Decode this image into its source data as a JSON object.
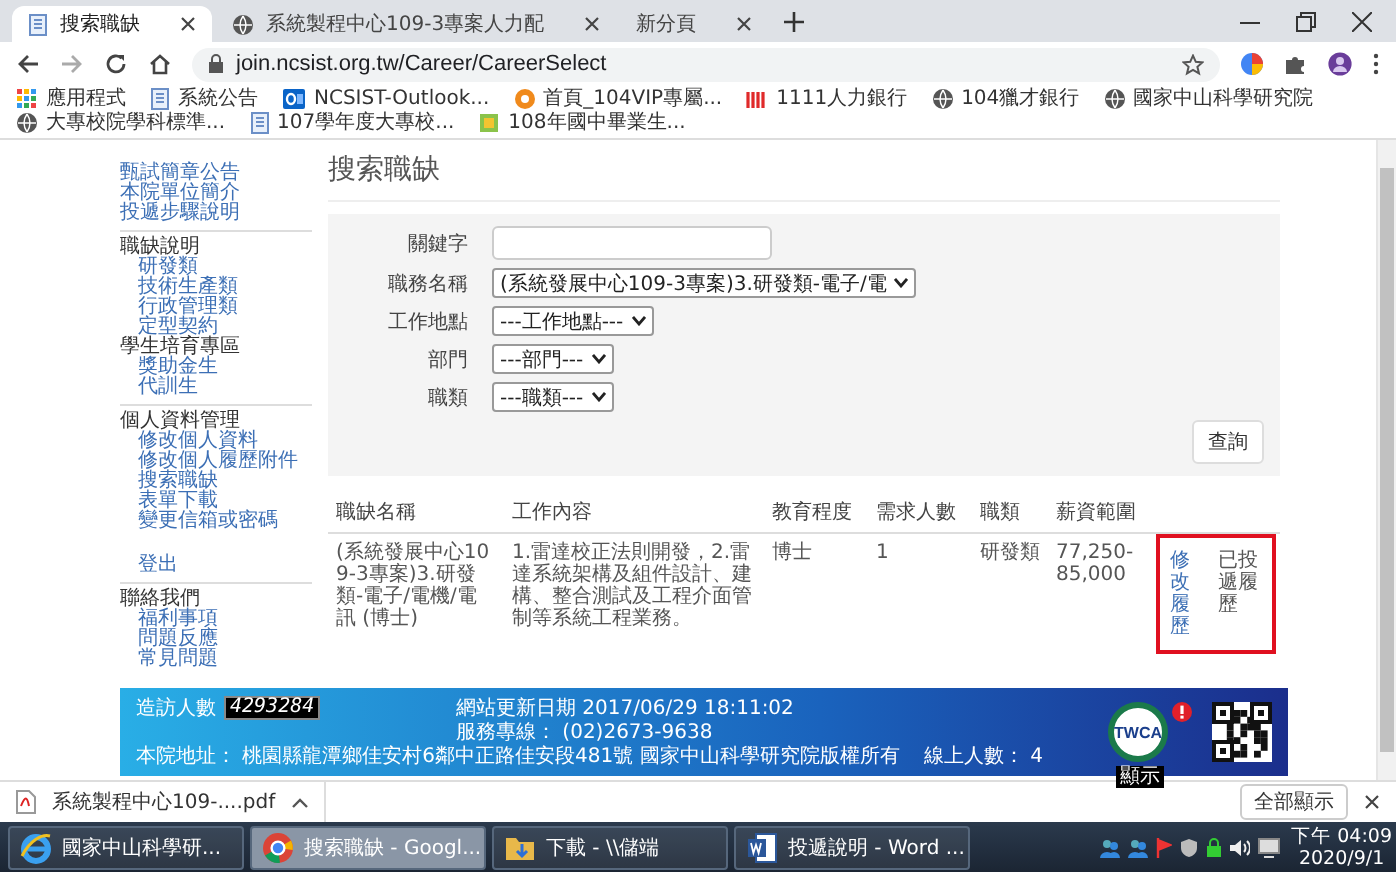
{
  "browser": {
    "tabs": [
      {
        "title": "搜索職缺",
        "kind": "page",
        "selected": true
      },
      {
        "title": "系統製程中心109-3專案人力配",
        "kind": "globe",
        "selected": false
      },
      {
        "title": "新分頁",
        "kind": "blank",
        "selected": false
      }
    ],
    "url": "join.ncsist.org.tw/Career/CareerSelect",
    "bookmarks": [
      {
        "label": "應用程式",
        "kind": "apps"
      },
      {
        "label": "系統公告",
        "kind": "page"
      },
      {
        "label": "NCSIST-Outlook...",
        "kind": "mail"
      },
      {
        "label": "首頁_104VIP專屬...",
        "kind": "badge"
      },
      {
        "label": "1111人力銀行",
        "kind": "bars"
      },
      {
        "label": "104獵才銀行",
        "kind": "globe"
      },
      {
        "label": "國家中山科學研究院",
        "kind": "globe"
      },
      {
        "label": "大專校院學科標準...",
        "kind": "globe"
      },
      {
        "label": "107學年度大專校...",
        "kind": "page"
      },
      {
        "label": "108年國中畢業生...",
        "kind": "book"
      }
    ]
  },
  "sidebar": {
    "groups": [
      {
        "divider": false,
        "items": [
          {
            "kind": "link",
            "label": "甄試簡章公告"
          },
          {
            "kind": "link",
            "label": "本院單位簡介"
          },
          {
            "kind": "link",
            "label": "投遞步驟說明"
          }
        ]
      },
      {
        "divider": true,
        "items": [
          {
            "kind": "header",
            "label": "職缺說明"
          },
          {
            "kind": "sublink",
            "label": "研發類"
          },
          {
            "kind": "sublink",
            "label": "技術生產類"
          },
          {
            "kind": "sublink",
            "label": "行政管理類"
          },
          {
            "kind": "sublink",
            "label": "定型契約"
          },
          {
            "kind": "header",
            "label": "學生培育專區"
          },
          {
            "kind": "sublink",
            "label": "獎助金生"
          },
          {
            "kind": "sublink",
            "label": "代訓生"
          }
        ]
      },
      {
        "divider": true,
        "items": [
          {
            "kind": "header",
            "label": "個人資料管理"
          },
          {
            "kind": "sublink",
            "label": "修改個人資料"
          },
          {
            "kind": "sublink",
            "label": "修改個人履歷附件"
          },
          {
            "kind": "sublink",
            "label": "搜索職缺"
          },
          {
            "kind": "sublink",
            "label": "表單下載"
          },
          {
            "kind": "sublink",
            "label": "變更信箱或密碼"
          }
        ]
      },
      {
        "divider": false,
        "items": [
          {
            "kind": "sublink",
            "label": "登出"
          }
        ]
      },
      {
        "divider": true,
        "items": [
          {
            "kind": "header",
            "label": "聯絡我們"
          },
          {
            "kind": "sublink",
            "label": "福利事項"
          },
          {
            "kind": "sublink",
            "label": "問題反應"
          },
          {
            "kind": "sublink",
            "label": "常見問題"
          }
        ]
      }
    ]
  },
  "page": {
    "title": "搜索職缺",
    "form": {
      "fields": [
        {
          "kind": "text",
          "label": "關鍵字"
        },
        {
          "kind": "select",
          "label": "職務名稱",
          "value": "(系統發展中心109-3專案)3.研發類-電子/電"
        },
        {
          "kind": "select",
          "label": "工作地點",
          "value": "---工作地點---"
        },
        {
          "kind": "select",
          "label": "部門",
          "value": "---部門---"
        },
        {
          "kind": "select",
          "label": "職類",
          "value": "---職類---"
        }
      ],
      "submit": "查詢"
    },
    "table": {
      "columns": [
        "職缺名稱",
        "工作內容",
        "教育程度",
        "需求人數",
        "職類",
        "薪資範圍"
      ],
      "rows": [
        {
          "cells": [
            "(系統發展中心109-3專案)3.研發類-電子/電機/電訊 (博士)",
            "1.雷達校正法則開發，2.雷達系統架構及組件設計、建構、整合測試及工程介面管制等系統工程業務。",
            "博士",
            "1",
            "研發類",
            "77,250-85,000"
          ],
          "actions": [
            {
              "kind": "link",
              "label": "修改履歷"
            },
            {
              "kind": "text",
              "label": "已投遞履歷"
            }
          ],
          "highlighted": true
        }
      ]
    }
  },
  "footer": {
    "visitors_label": "造訪人數",
    "visitors": "4293284",
    "updated": "網站更新日期 2017/06/29 18:11:02",
    "phone": "服務專線： (02)2673-9638",
    "address": "本院地址： 桃園縣龍潭鄉佳安村6鄰中正路佳安段481號 國家中山科學研究院版權所有",
    "online": "線上人數： 4",
    "seal": "TWCA",
    "tooltip": "顯示"
  },
  "downloads": {
    "items": [
      {
        "name": "系統製程中心109-....pdf"
      }
    ],
    "show_all": "全部顯示"
  },
  "taskbar": {
    "items": [
      {
        "title": "國家中山科學研...",
        "kind": "e",
        "selected": false
      },
      {
        "title": "搜索職缺 - Googl...",
        "kind": "chrome",
        "selected": true
      },
      {
        "title": "下載 - \\\\儲端",
        "kind": "folder",
        "selected": false
      },
      {
        "title": "投遞說明 - Word ...",
        "kind": "word",
        "selected": false
      }
    ],
    "time": "下午 04:09",
    "date": "2020/9/1"
  }
}
